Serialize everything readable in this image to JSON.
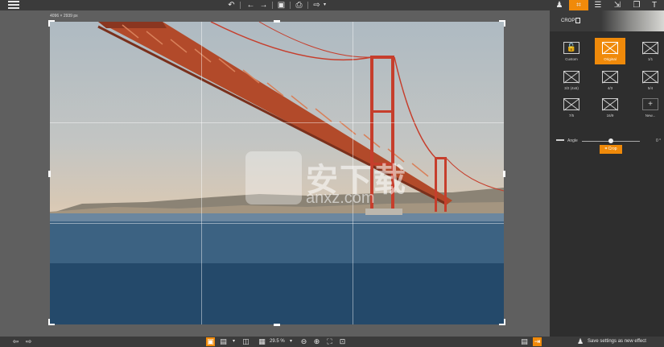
{
  "toolbar": {
    "menu_icon": "hamburger-icon",
    "undo_icon": "↶",
    "back_icon": "←",
    "forward_icon": "→",
    "save_icon": "💾",
    "print_icon": "⎙",
    "share_icon": "⇪"
  },
  "right_tabs": [
    {
      "name": "effects-tab",
      "glyph": "♟"
    },
    {
      "name": "crop-tab",
      "glyph": "⌗"
    },
    {
      "name": "adjust-tab",
      "glyph": "☰"
    },
    {
      "name": "export-tab",
      "glyph": "⇲"
    },
    {
      "name": "layers-tab",
      "glyph": "❐"
    },
    {
      "name": "text-tab",
      "glyph": "T"
    }
  ],
  "canvas": {
    "image_dimensions": "4096 × 2939 px"
  },
  "watermark": {
    "text": "安下载",
    "sub": "anxz.com"
  },
  "panel": {
    "title": "CROP",
    "presets": [
      {
        "label": "Custom",
        "active": false,
        "plain": true
      },
      {
        "label": "Original",
        "active": true,
        "plain": false
      },
      {
        "label": "1/1",
        "active": false,
        "plain": false
      },
      {
        "label": "3/2 (4x6)",
        "active": false,
        "plain": false
      },
      {
        "label": "4/3",
        "active": false,
        "plain": false
      },
      {
        "label": "5/4",
        "active": false,
        "plain": false
      },
      {
        "label": "7/5",
        "active": false,
        "plain": false
      },
      {
        "label": "16/9",
        "active": false,
        "plain": false
      },
      {
        "label": "New...",
        "active": false,
        "plain": true
      }
    ],
    "angle_label": "Angle",
    "angle_value": "0 °",
    "angle_fraction": 0.5,
    "crop_button": "Crop"
  },
  "bottombar": {
    "zoom": "29.5 %",
    "save_effect": "Save settings as new effect"
  },
  "colors": {
    "accent": "#f08a0a",
    "toolbar": "#3b3b3b",
    "panel": "#2e2e2e",
    "canvas": "#5f5f5f"
  }
}
